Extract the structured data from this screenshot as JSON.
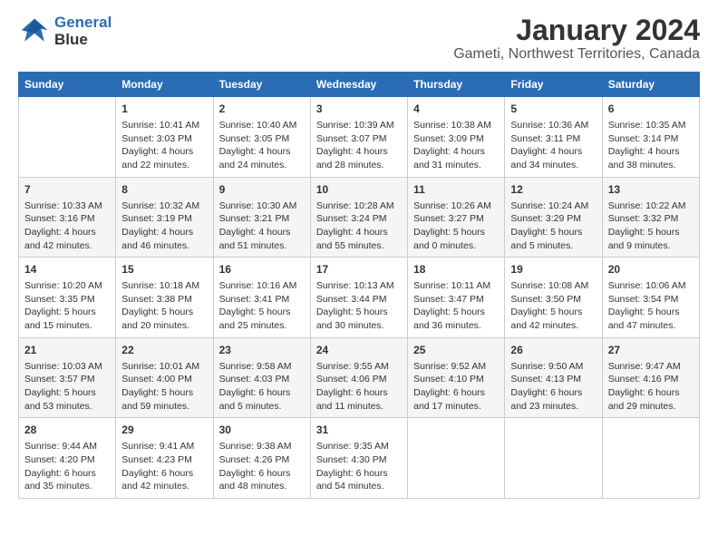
{
  "logo": {
    "line1": "General",
    "line2": "Blue"
  },
  "title": "January 2024",
  "subtitle": "Gameti, Northwest Territories, Canada",
  "weekdays": [
    "Sunday",
    "Monday",
    "Tuesday",
    "Wednesday",
    "Thursday",
    "Friday",
    "Saturday"
  ],
  "weeks": [
    [
      {
        "day": "",
        "info": ""
      },
      {
        "day": "1",
        "info": "Sunrise: 10:41 AM\nSunset: 3:03 PM\nDaylight: 4 hours\nand 22 minutes."
      },
      {
        "day": "2",
        "info": "Sunrise: 10:40 AM\nSunset: 3:05 PM\nDaylight: 4 hours\nand 24 minutes."
      },
      {
        "day": "3",
        "info": "Sunrise: 10:39 AM\nSunset: 3:07 PM\nDaylight: 4 hours\nand 28 minutes."
      },
      {
        "day": "4",
        "info": "Sunrise: 10:38 AM\nSunset: 3:09 PM\nDaylight: 4 hours\nand 31 minutes."
      },
      {
        "day": "5",
        "info": "Sunrise: 10:36 AM\nSunset: 3:11 PM\nDaylight: 4 hours\nand 34 minutes."
      },
      {
        "day": "6",
        "info": "Sunrise: 10:35 AM\nSunset: 3:14 PM\nDaylight: 4 hours\nand 38 minutes."
      }
    ],
    [
      {
        "day": "7",
        "info": "Sunrise: 10:33 AM\nSunset: 3:16 PM\nDaylight: 4 hours\nand 42 minutes."
      },
      {
        "day": "8",
        "info": "Sunrise: 10:32 AM\nSunset: 3:19 PM\nDaylight: 4 hours\nand 46 minutes."
      },
      {
        "day": "9",
        "info": "Sunrise: 10:30 AM\nSunset: 3:21 PM\nDaylight: 4 hours\nand 51 minutes."
      },
      {
        "day": "10",
        "info": "Sunrise: 10:28 AM\nSunset: 3:24 PM\nDaylight: 4 hours\nand 55 minutes."
      },
      {
        "day": "11",
        "info": "Sunrise: 10:26 AM\nSunset: 3:27 PM\nDaylight: 5 hours\nand 0 minutes."
      },
      {
        "day": "12",
        "info": "Sunrise: 10:24 AM\nSunset: 3:29 PM\nDaylight: 5 hours\nand 5 minutes."
      },
      {
        "day": "13",
        "info": "Sunrise: 10:22 AM\nSunset: 3:32 PM\nDaylight: 5 hours\nand 9 minutes."
      }
    ],
    [
      {
        "day": "14",
        "info": "Sunrise: 10:20 AM\nSunset: 3:35 PM\nDaylight: 5 hours\nand 15 minutes."
      },
      {
        "day": "15",
        "info": "Sunrise: 10:18 AM\nSunset: 3:38 PM\nDaylight: 5 hours\nand 20 minutes."
      },
      {
        "day": "16",
        "info": "Sunrise: 10:16 AM\nSunset: 3:41 PM\nDaylight: 5 hours\nand 25 minutes."
      },
      {
        "day": "17",
        "info": "Sunrise: 10:13 AM\nSunset: 3:44 PM\nDaylight: 5 hours\nand 30 minutes."
      },
      {
        "day": "18",
        "info": "Sunrise: 10:11 AM\nSunset: 3:47 PM\nDaylight: 5 hours\nand 36 minutes."
      },
      {
        "day": "19",
        "info": "Sunrise: 10:08 AM\nSunset: 3:50 PM\nDaylight: 5 hours\nand 42 minutes."
      },
      {
        "day": "20",
        "info": "Sunrise: 10:06 AM\nSunset: 3:54 PM\nDaylight: 5 hours\nand 47 minutes."
      }
    ],
    [
      {
        "day": "21",
        "info": "Sunrise: 10:03 AM\nSunset: 3:57 PM\nDaylight: 5 hours\nand 53 minutes."
      },
      {
        "day": "22",
        "info": "Sunrise: 10:01 AM\nSunset: 4:00 PM\nDaylight: 5 hours\nand 59 minutes."
      },
      {
        "day": "23",
        "info": "Sunrise: 9:58 AM\nSunset: 4:03 PM\nDaylight: 6 hours\nand 5 minutes."
      },
      {
        "day": "24",
        "info": "Sunrise: 9:55 AM\nSunset: 4:06 PM\nDaylight: 6 hours\nand 11 minutes."
      },
      {
        "day": "25",
        "info": "Sunrise: 9:52 AM\nSunset: 4:10 PM\nDaylight: 6 hours\nand 17 minutes."
      },
      {
        "day": "26",
        "info": "Sunrise: 9:50 AM\nSunset: 4:13 PM\nDaylight: 6 hours\nand 23 minutes."
      },
      {
        "day": "27",
        "info": "Sunrise: 9:47 AM\nSunset: 4:16 PM\nDaylight: 6 hours\nand 29 minutes."
      }
    ],
    [
      {
        "day": "28",
        "info": "Sunrise: 9:44 AM\nSunset: 4:20 PM\nDaylight: 6 hours\nand 35 minutes."
      },
      {
        "day": "29",
        "info": "Sunrise: 9:41 AM\nSunset: 4:23 PM\nDaylight: 6 hours\nand 42 minutes."
      },
      {
        "day": "30",
        "info": "Sunrise: 9:38 AM\nSunset: 4:26 PM\nDaylight: 6 hours\nand 48 minutes."
      },
      {
        "day": "31",
        "info": "Sunrise: 9:35 AM\nSunset: 4:30 PM\nDaylight: 6 hours\nand 54 minutes."
      },
      {
        "day": "",
        "info": ""
      },
      {
        "day": "",
        "info": ""
      },
      {
        "day": "",
        "info": ""
      }
    ]
  ]
}
